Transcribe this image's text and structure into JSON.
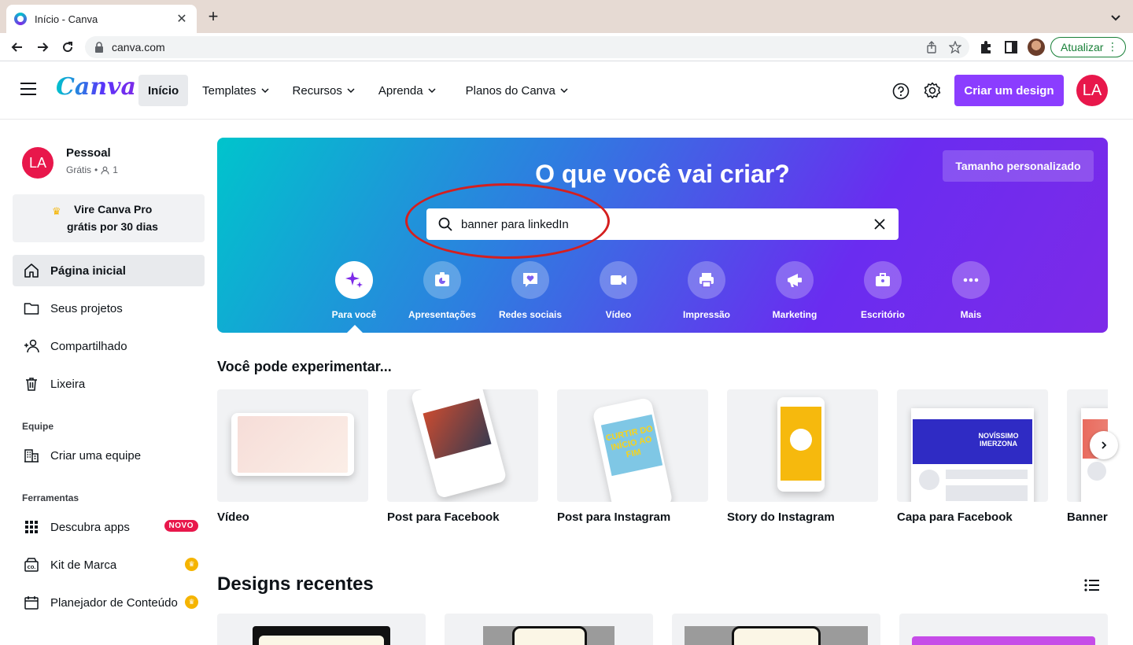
{
  "browser": {
    "tab_title": "Início - Canva",
    "url": "canva.com",
    "update_label": "Atualizar"
  },
  "header": {
    "logo": "Canva",
    "nav": [
      {
        "label": "Início"
      },
      {
        "label": "Templates"
      },
      {
        "label": "Recursos"
      },
      {
        "label": "Aprenda"
      },
      {
        "label": "Planos do Canva"
      }
    ],
    "create_label": "Criar um design",
    "avatar_initials": "LA"
  },
  "sidebar": {
    "account": {
      "initials": "LA",
      "name": "Pessoal",
      "plan": "Grátis",
      "members": "1"
    },
    "promo": {
      "line1": "Vire Canva Pro",
      "line2": "grátis por 30 dias"
    },
    "items": [
      {
        "label": "Página inicial"
      },
      {
        "label": "Seus projetos"
      },
      {
        "label": "Compartilhado"
      },
      {
        "label": "Lixeira"
      }
    ],
    "team_heading": "Equipe",
    "team_item": "Criar uma equipe",
    "tools_heading": "Ferramentas",
    "tools": [
      {
        "label": "Descubra apps",
        "badge": "NOVO"
      },
      {
        "label": "Kit de Marca"
      },
      {
        "label": "Planejador de Conteúdo"
      }
    ]
  },
  "hero": {
    "title": "O que você vai criar?",
    "custom_size": "Tamanho personalizado",
    "search_value": "banner para linkedIn",
    "categories": [
      {
        "label": "Para você"
      },
      {
        "label": "Apresentações"
      },
      {
        "label": "Redes sociais"
      },
      {
        "label": "Vídeo"
      },
      {
        "label": "Impressão"
      },
      {
        "label": "Marketing"
      },
      {
        "label": "Escritório"
      },
      {
        "label": "Mais"
      }
    ]
  },
  "suggestions": {
    "title": "Você pode experimentar...",
    "cards": [
      {
        "label": "Vídeo"
      },
      {
        "label": "Post para Facebook"
      },
      {
        "label": "Post para Instagram"
      },
      {
        "label": "Story do Instagram"
      },
      {
        "label": "Capa para Facebook"
      },
      {
        "label": "Banner"
      }
    ],
    "facebook_cover_text": "NOVÍSSIMO IMERZONA",
    "instagram_post_text": "CURTIR DO INÍCIO AO FIM"
  },
  "recent": {
    "title": "Designs recentes"
  },
  "colors": {
    "brand_purple": "#8b3dff",
    "avatar_red": "#e8174b",
    "hero_start": "#00c4cc",
    "hero_end": "#7d2ae8"
  }
}
